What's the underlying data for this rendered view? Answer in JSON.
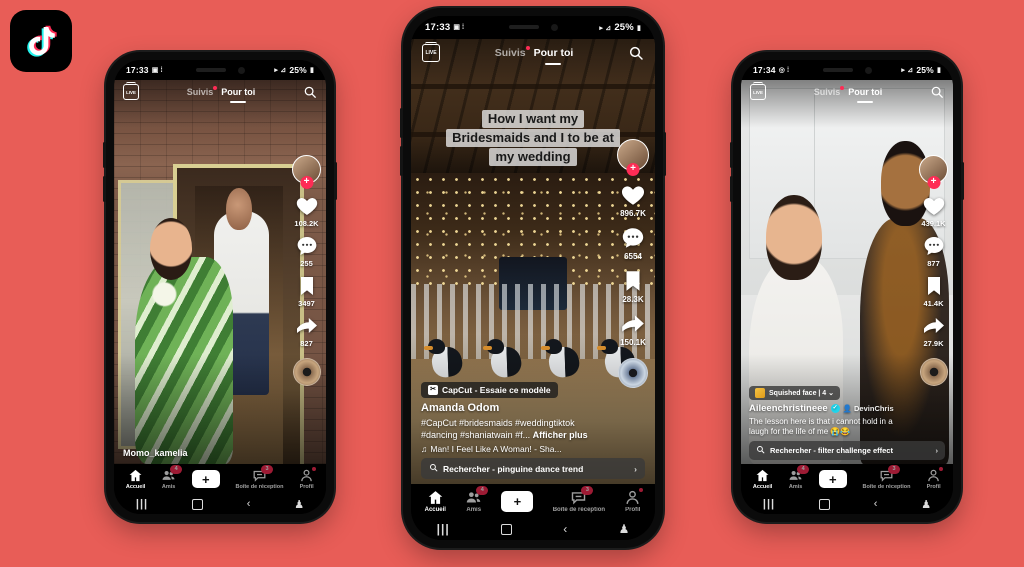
{
  "background_color": "#E85D57",
  "brand": {
    "logo_name": "tiktok-logo",
    "logo_bg": "#000000",
    "accent_pink": "#FE2C55",
    "accent_cyan": "#20D5EC"
  },
  "phones": [
    {
      "id": "left",
      "status_bar": {
        "time": "17:33",
        "glyphs": "▣ ⦙",
        "signal": "▸ ⊿",
        "battery": "25%"
      },
      "top_bar": {
        "live_label": "LIVE",
        "tab_following": "Suivis",
        "tab_foryou": "Pour toi",
        "search_icon": "search-icon"
      },
      "rail": {
        "like_count": "108.2K",
        "comment_count": "255",
        "bookmark_count": "3497",
        "share_count": "827"
      },
      "username": "Momo_kamelia",
      "bottom_nav": [
        {
          "label": "Accueil",
          "icon": "home-icon",
          "badge": ""
        },
        {
          "label": "Amis",
          "icon": "friends-icon",
          "badge": "4"
        },
        {
          "label": "",
          "icon": "create-plus-icon",
          "badge": ""
        },
        {
          "label": "Boîte de réception",
          "icon": "inbox-icon",
          "badge": "3"
        },
        {
          "label": "Profil",
          "icon": "profile-icon",
          "badge": "dot"
        }
      ]
    },
    {
      "id": "center",
      "status_bar": {
        "time": "17:33",
        "glyphs": "▣ ⦙",
        "signal": "▸ ⊿",
        "battery": "25%"
      },
      "top_bar": {
        "live_label": "LIVE",
        "tab_following": "Suivis",
        "tab_foryou": "Pour toi",
        "search_icon": "search-icon"
      },
      "sticker_caption": [
        "How I want my",
        "Bridesmaids and I to be at",
        "my wedding"
      ],
      "capcut_chip": "CapCut - Essaie ce modèle",
      "username": "Amanda Odom",
      "description_line1": "#CapCut #bridesmaids #weddingtiktok",
      "description_line2": "#dancing #shaniatwain #f...",
      "more_label": "Afficher plus",
      "music": "Man! I Feel Like A Woman! - Sha...",
      "search_suggestion": "Rechercher - pinguine dance trend",
      "rail": {
        "like_count": "896.7K",
        "comment_count": "6554",
        "bookmark_count": "28.3K",
        "share_count": "150.1K"
      },
      "bottom_nav": [
        {
          "label": "Accueil",
          "icon": "home-icon",
          "badge": ""
        },
        {
          "label": "Amis",
          "icon": "friends-icon",
          "badge": "4"
        },
        {
          "label": "",
          "icon": "create-plus-icon",
          "badge": ""
        },
        {
          "label": "Boîte de réception",
          "icon": "inbox-icon",
          "badge": "3"
        },
        {
          "label": "Profil",
          "icon": "profile-icon",
          "badge": "dot"
        }
      ]
    },
    {
      "id": "right",
      "status_bar": {
        "time": "17:34",
        "glyphs": "◎ ⦙",
        "signal": "▸ ⊿",
        "battery": "25%"
      },
      "top_bar": {
        "live_label": "LIVE",
        "tab_following": "Suivis",
        "tab_foryou": "Pour toi",
        "search_icon": "search-icon"
      },
      "effect_chip": "Squished face  |  4 ⌄",
      "username": "Aileenchristineee",
      "mention": "DevinChris",
      "description_line1": "The lesson here is that i cannot hold in a",
      "description_line2": "laugh for the life of me 😭😂",
      "search_suggestion": "Rechercher - filter challenge effect",
      "rail": {
        "like_count": "439.1K",
        "comment_count": "877",
        "bookmark_count": "41.4K",
        "share_count": "27.9K"
      },
      "bottom_nav": [
        {
          "label": "Accueil",
          "icon": "home-icon",
          "badge": ""
        },
        {
          "label": "Amis",
          "icon": "friends-icon",
          "badge": "4"
        },
        {
          "label": "",
          "icon": "create-plus-icon",
          "badge": ""
        },
        {
          "label": "Boîte de réception",
          "icon": "inbox-icon",
          "badge": "3"
        },
        {
          "label": "Profil",
          "icon": "profile-icon",
          "badge": "dot"
        }
      ]
    }
  ],
  "system_nav": {
    "recents": "|||",
    "home": "home-square",
    "back": "‹",
    "accessibility": "⚕"
  }
}
